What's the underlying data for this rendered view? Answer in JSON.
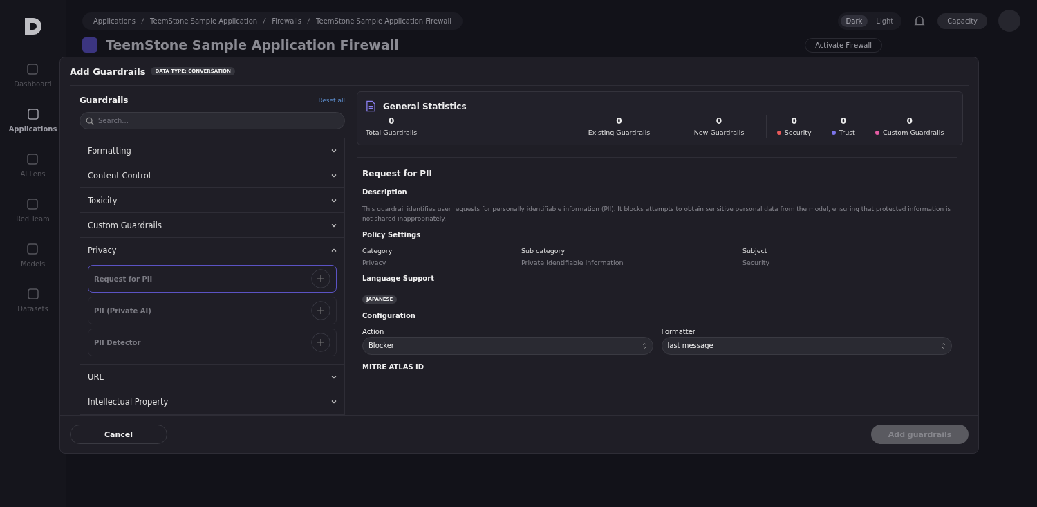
{
  "sidebar": {
    "items": [
      {
        "label": "Dashboard",
        "selected": false
      },
      {
        "label": "Applications",
        "selected": true
      },
      {
        "label": "AI Lens",
        "selected": false
      },
      {
        "label": "Red Team",
        "selected": false
      },
      {
        "label": "Models",
        "selected": false
      },
      {
        "label": "Datasets",
        "selected": false
      }
    ]
  },
  "topbar": {
    "breadcrumbs": [
      "Applications",
      "TeemStone Sample Application",
      "Firewalls",
      "TeemStone Sample Application Firewall"
    ],
    "theme": [
      {
        "label": "Dark",
        "selected": true
      },
      {
        "label": "Light",
        "selected": false
      }
    ],
    "capacity": "Capacity"
  },
  "page": {
    "title": "TeemStone Sample Application Firewall",
    "action": "Activate Firewall"
  },
  "modal": {
    "title": "Add Guardrails",
    "badge": "DATA TYPE: CONVERSATION",
    "left": {
      "heading": "Guardrails",
      "reset": "Reset all",
      "search": {
        "placeholder": "Search..."
      },
      "groups": [
        {
          "label": "Formatting",
          "expanded": false
        },
        {
          "label": "Content Control",
          "expanded": false
        },
        {
          "label": "Toxicity",
          "expanded": false
        },
        {
          "label": "Custom Guardrails",
          "expanded": false
        },
        {
          "label": "Privacy",
          "expanded": true,
          "items": [
            {
              "label": "Request for PII",
              "selected": true
            },
            {
              "label": "PII (Private AI)",
              "selected": false
            },
            {
              "label": "PII Detector",
              "selected": false
            }
          ]
        },
        {
          "label": "URL",
          "expanded": false
        },
        {
          "label": "Intellectual Property",
          "expanded": false
        }
      ]
    },
    "stats": {
      "title": "General Statistics",
      "sections": [
        {
          "items": [
            {
              "value": "0",
              "label": "Total Guardrails"
            }
          ]
        },
        {
          "items": [
            {
              "value": "0",
              "label": "Existing Guardrails"
            },
            {
              "value": "0",
              "label": "New Guardrails"
            }
          ]
        },
        {
          "items": [
            {
              "value": "0",
              "label": "Security",
              "color": "#e8595a"
            },
            {
              "value": "0",
              "label": "Trust",
              "color": "#7c74ea"
            },
            {
              "value": "0",
              "label": "Custom Guardrails",
              "color": "#e35ca3"
            }
          ]
        }
      ]
    },
    "detail": {
      "title": "Request for PII",
      "description_heading": "Description",
      "description": "This guardrail identifies user requests for personally identifiable information (PII). It blocks attempts to obtain sensitive personal data from the model, ensuring that protected information is not shared inappropriately.",
      "policy_heading": "Policy Settings",
      "policy": [
        {
          "label": "Category",
          "value": "Privacy"
        },
        {
          "label": "Sub category",
          "value": "Private Identifiable Information"
        },
        {
          "label": "Subject",
          "value": "Security"
        }
      ],
      "language_heading": "Language Support",
      "languages": [
        "JAPANESE"
      ],
      "configuration_heading": "Configuration",
      "fields": [
        {
          "label": "Action",
          "value": "Blocker"
        },
        {
          "label": "Formatter",
          "value": "last message"
        }
      ],
      "mitre_heading": "MITRE ATLAS ID"
    },
    "footer": {
      "cancel": "Cancel",
      "submit": {
        "label": "Add guardrails",
        "disabled": true
      }
    }
  }
}
